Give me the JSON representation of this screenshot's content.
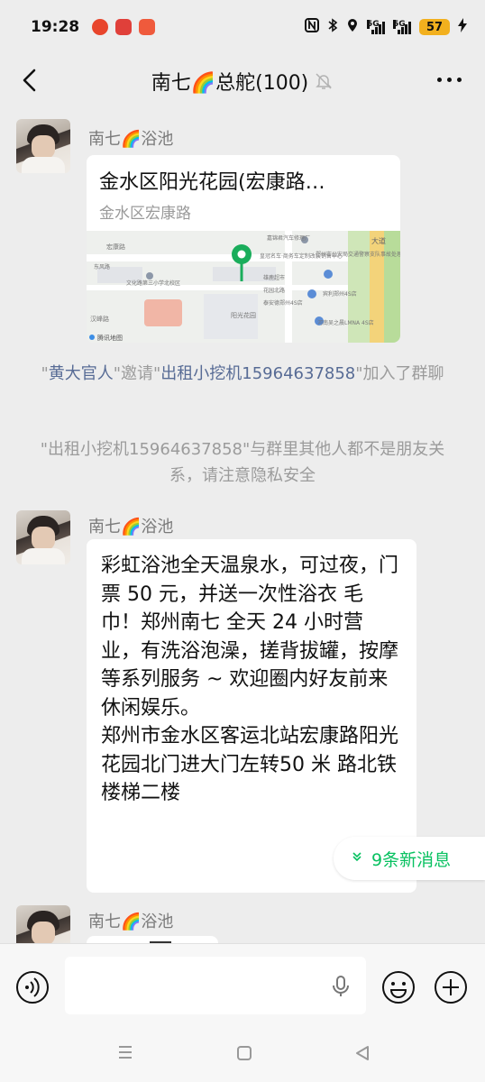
{
  "status_bar": {
    "time": "19:28",
    "battery": "57",
    "network_1": "5G",
    "network_2": "5G"
  },
  "header": {
    "title": "南七🌈总舵(100)"
  },
  "messages": {
    "location_sender": "南七🌈浴池",
    "location_title": "金水区阳光花园(宏康路…",
    "location_subtitle": "金水区宏康路",
    "map_labels": {
      "road1": "宏康路",
      "poi1": "文化路第三小学北校区",
      "poi2": "嘉锦君汽车修理厂",
      "poi3": "皇冠名车·商务车定制改装销售中心",
      "poi4": "郑州市公安局交通警察支队事故处理事务所",
      "poi5": "雄鹿超市",
      "poi6": "宾利郑州4S店",
      "poi7": "泰安德郑州4S店",
      "poi8": "河南吴之晨LMNA 4S店",
      "road2": "花园北路",
      "area": "阳光花园",
      "logo": "腾讯地图",
      "road3": "汉峰路",
      "road4": "大道",
      "road5": "东风路"
    },
    "invite_prefix": "\"",
    "invite_inviter": "黄大官人",
    "invite_mid": "\"邀请\"",
    "invite_invitee": "出租小挖机15964637858",
    "invite_suffix": "\"加入了群聊",
    "privacy_notice": "\"出租小挖机15964637858\"与群里其他人都不是朋友关系，请注意隐私安全",
    "text_sender": "南七🌈浴池",
    "text_body": "彩虹浴池全天温泉水，可过夜，门票 50 元，并送一次性浴衣 毛巾！郑州南七 全天 24 小时营业，有洗浴泡澡，搓背拔罐，按摩等系列服务 ~ 欢迎圈内好友前来休闲娱乐。\n郑州市金水区客运北站宏康路阳光花园北门进大门左转50 米 路北铁楼梯二楼",
    "third_sender": "南七🌈浴池"
  },
  "new_messages_pill": "9条新消息",
  "colors": {
    "accent_green": "#07c160",
    "link_blue": "#576b95",
    "background": "#ededed"
  }
}
